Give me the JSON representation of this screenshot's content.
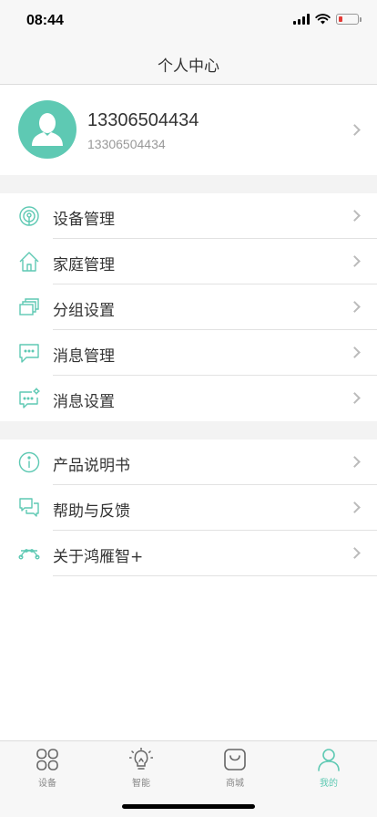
{
  "status": {
    "time": "08:44"
  },
  "header": {
    "title": "个人中心"
  },
  "profile": {
    "name": "13306504434",
    "phone": "13306504434"
  },
  "menu_group1": [
    {
      "label": "设备管理",
      "icon": "device-signal-icon"
    },
    {
      "label": "家庭管理",
      "icon": "home-icon"
    },
    {
      "label": "分组设置",
      "icon": "stacked-cards-icon"
    },
    {
      "label": "消息管理",
      "icon": "chat-bubble-icon"
    },
    {
      "label": "消息设置",
      "icon": "chat-settings-icon"
    }
  ],
  "menu_group2": [
    {
      "label": "产品说明书",
      "icon": "info-icon"
    },
    {
      "label": "帮助与反馈",
      "icon": "feedback-icon"
    },
    {
      "label": "关于鸿雁智+",
      "icon": "curve-nodes-icon"
    }
  ],
  "tabs": [
    {
      "label": "设备",
      "icon": "grid-icon",
      "active": false
    },
    {
      "label": "智能",
      "icon": "lightbulb-icon",
      "active": false
    },
    {
      "label": "商城",
      "icon": "shopping-bag-icon",
      "active": false
    },
    {
      "label": "我的",
      "icon": "person-icon",
      "active": true
    }
  ],
  "colors": {
    "accent": "#5ec9b3",
    "text": "#333333",
    "subtext": "#999999",
    "separator": "#f3f3f3"
  }
}
